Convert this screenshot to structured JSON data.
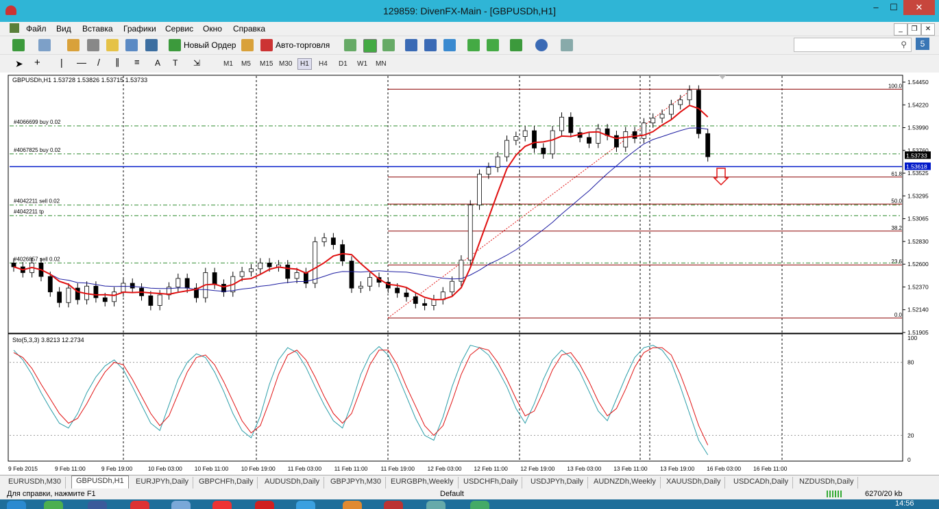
{
  "window": {
    "title": "129859: DivenFX-Main - [GBPUSDh,H1]",
    "min": "–",
    "max": "☐",
    "close": "✕"
  },
  "menu": [
    "Файл",
    "Вид",
    "Вставка",
    "Графики",
    "Сервис",
    "Окно",
    "Справка"
  ],
  "toolbar": {
    "new_order": "Новый Ордер",
    "auto_trading": "Авто-торговля"
  },
  "timeframes": [
    "M1",
    "M5",
    "M15",
    "M30",
    "H1",
    "H4",
    "D1",
    "W1",
    "MN"
  ],
  "active_timeframe": "H1",
  "chart": {
    "header": "GBPUSDh,H1  1.53728 1.53826 1.53715 1.53733",
    "order_labels": [
      {
        "text": "#4066699 buy 0.02",
        "price": 1.5404
      },
      {
        "text": "#4067825 buy 0.02",
        "price": 1.5375
      },
      {
        "text": "#4042211 sell 0.02",
        "price": 1.5322
      },
      {
        "text": "#4042211 tp",
        "price": 1.5311
      },
      {
        "text": "#4026857 sell 0.02",
        "price": 1.5262
      }
    ],
    "price_axis": [
      "1.54450",
      "1.54220",
      "1.53990",
      "1.53760",
      "1.53525",
      "1.53295",
      "1.53065",
      "1.52830",
      "1.52600",
      "1.52370",
      "1.52140",
      "1.51905"
    ],
    "current_price": "1.53733",
    "line_price": "1.53618",
    "fib_levels": [
      {
        "label": "100.0",
        "price": 1.5442
      },
      {
        "label": "61.8",
        "price": 1.5351
      },
      {
        "label": "50.0",
        "price": 1.5323
      },
      {
        "label": "38.2",
        "price": 1.5295
      },
      {
        "label": "23.6",
        "price": 1.526
      },
      {
        "label": "0.0",
        "price": 1.5205
      }
    ],
    "stoch_header": "Sto(5,3,3) 3.8213 12.2734",
    "stoch_axis": [
      "100",
      "80",
      "20",
      "0"
    ],
    "time_axis": [
      "9 Feb 2015",
      "9 Feb 11:00",
      "9 Feb 19:00",
      "10 Feb 03:00",
      "10 Feb 11:00",
      "10 Feb 19:00",
      "11 Feb 03:00",
      "11 Feb 11:00",
      "11 Feb 19:00",
      "12 Feb 03:00",
      "12 Feb 11:00",
      "12 Feb 19:00",
      "13 Feb 03:00",
      "13 Feb 11:00",
      "13 Feb 19:00",
      "16 Feb 03:00",
      "16 Feb 11:00"
    ],
    "colors": {
      "bull": "#ffffff",
      "bear": "#000000",
      "ma_fast": "#e01010",
      "ma_slow": "#1a1aa0",
      "hline": "#0018c8",
      "stoch_main": "#2a9da8",
      "stoch_signal": "#e01010",
      "fib": "#8b0000"
    }
  },
  "chart_data": {
    "type": "candlestick",
    "symbol": "GBPUSDh",
    "timeframe": "H1",
    "ylim": [
      1.519,
      1.5455
    ],
    "close": [
      1.5258,
      1.5252,
      1.5262,
      1.5248,
      1.5232,
      1.5221,
      1.5236,
      1.5224,
      1.5238,
      1.5226,
      1.5222,
      1.5232,
      1.5241,
      1.5236,
      1.5228,
      1.5218,
      1.5229,
      1.5237,
      1.5246,
      1.5236,
      1.5226,
      1.5252,
      1.524,
      1.5232,
      1.5248,
      1.5253,
      1.5256,
      1.5262,
      1.5258,
      1.526,
      1.5246,
      1.5252,
      1.5241,
      1.5284,
      1.5288,
      1.5281,
      1.5264,
      1.5236,
      1.5238,
      1.5247,
      1.5242,
      1.5236,
      1.5231,
      1.5227,
      1.522,
      1.5218,
      1.5224,
      1.5232,
      1.5243,
      1.5265,
      1.5322,
      1.5354,
      1.5361,
      1.5372,
      1.5389,
      1.5393,
      1.5399,
      1.5381,
      1.5375,
      1.5399,
      1.5413,
      1.5397,
      1.5392,
      1.5386,
      1.5401,
      1.5394,
      1.5382,
      1.5398,
      1.5391,
      1.5407,
      1.5412,
      1.5416,
      1.5426,
      1.5431,
      1.5441,
      1.5396,
      1.5372
    ],
    "stoch_main": [
      90,
      82,
      70,
      55,
      42,
      30,
      26,
      38,
      55,
      68,
      77,
      82,
      74,
      60,
      45,
      30,
      24,
      45,
      66,
      80,
      87,
      84,
      72,
      56,
      38,
      24,
      18,
      36,
      62,
      82,
      92,
      88,
      76,
      60,
      45,
      32,
      26,
      46,
      70,
      86,
      93,
      86,
      70,
      52,
      34,
      20,
      16,
      35,
      60,
      80,
      94,
      92,
      86,
      74,
      60,
      42,
      30,
      46,
      66,
      82,
      90,
      84,
      72,
      56,
      40,
      32,
      50,
      68,
      84,
      92,
      94,
      90,
      80,
      60,
      38,
      16,
      4
    ],
    "stoch_signal": [
      88,
      84,
      75,
      62,
      50,
      38,
      30,
      34,
      46,
      60,
      72,
      80,
      78,
      66,
      52,
      38,
      28,
      36,
      54,
      72,
      84,
      86,
      78,
      64,
      48,
      32,
      22,
      28,
      48,
      70,
      86,
      90,
      82,
      68,
      52,
      38,
      30,
      38,
      58,
      78,
      90,
      90,
      78,
      60,
      44,
      28,
      20,
      28,
      48,
      70,
      86,
      92,
      90,
      80,
      66,
      50,
      36,
      40,
      56,
      74,
      86,
      88,
      78,
      64,
      48,
      36,
      42,
      58,
      76,
      88,
      92,
      92,
      86,
      70,
      50,
      28,
      12
    ]
  },
  "tabs": [
    "EURUSDh,M30",
    "GBPUSDh,H1",
    "EURJPYh,Daily",
    "GBPCHFh,Daily",
    "AUDUSDh,Daily",
    "GBPJPYh,M30",
    "EURGBPh,Weekly",
    "USDCHFh,Daily",
    "USDJPYh,Daily",
    "AUDNZDh,Weekly",
    "XAUUSDh,Daily",
    "USDCADh,Daily",
    "NZDUSDh,Daily"
  ],
  "active_tab": "GBPUSDh,H1",
  "status": {
    "help": "Для справки, нажмите F1",
    "profile": "Default",
    "traffic": "6270/20 kb"
  },
  "taskbar": {
    "clock": "14:56"
  }
}
